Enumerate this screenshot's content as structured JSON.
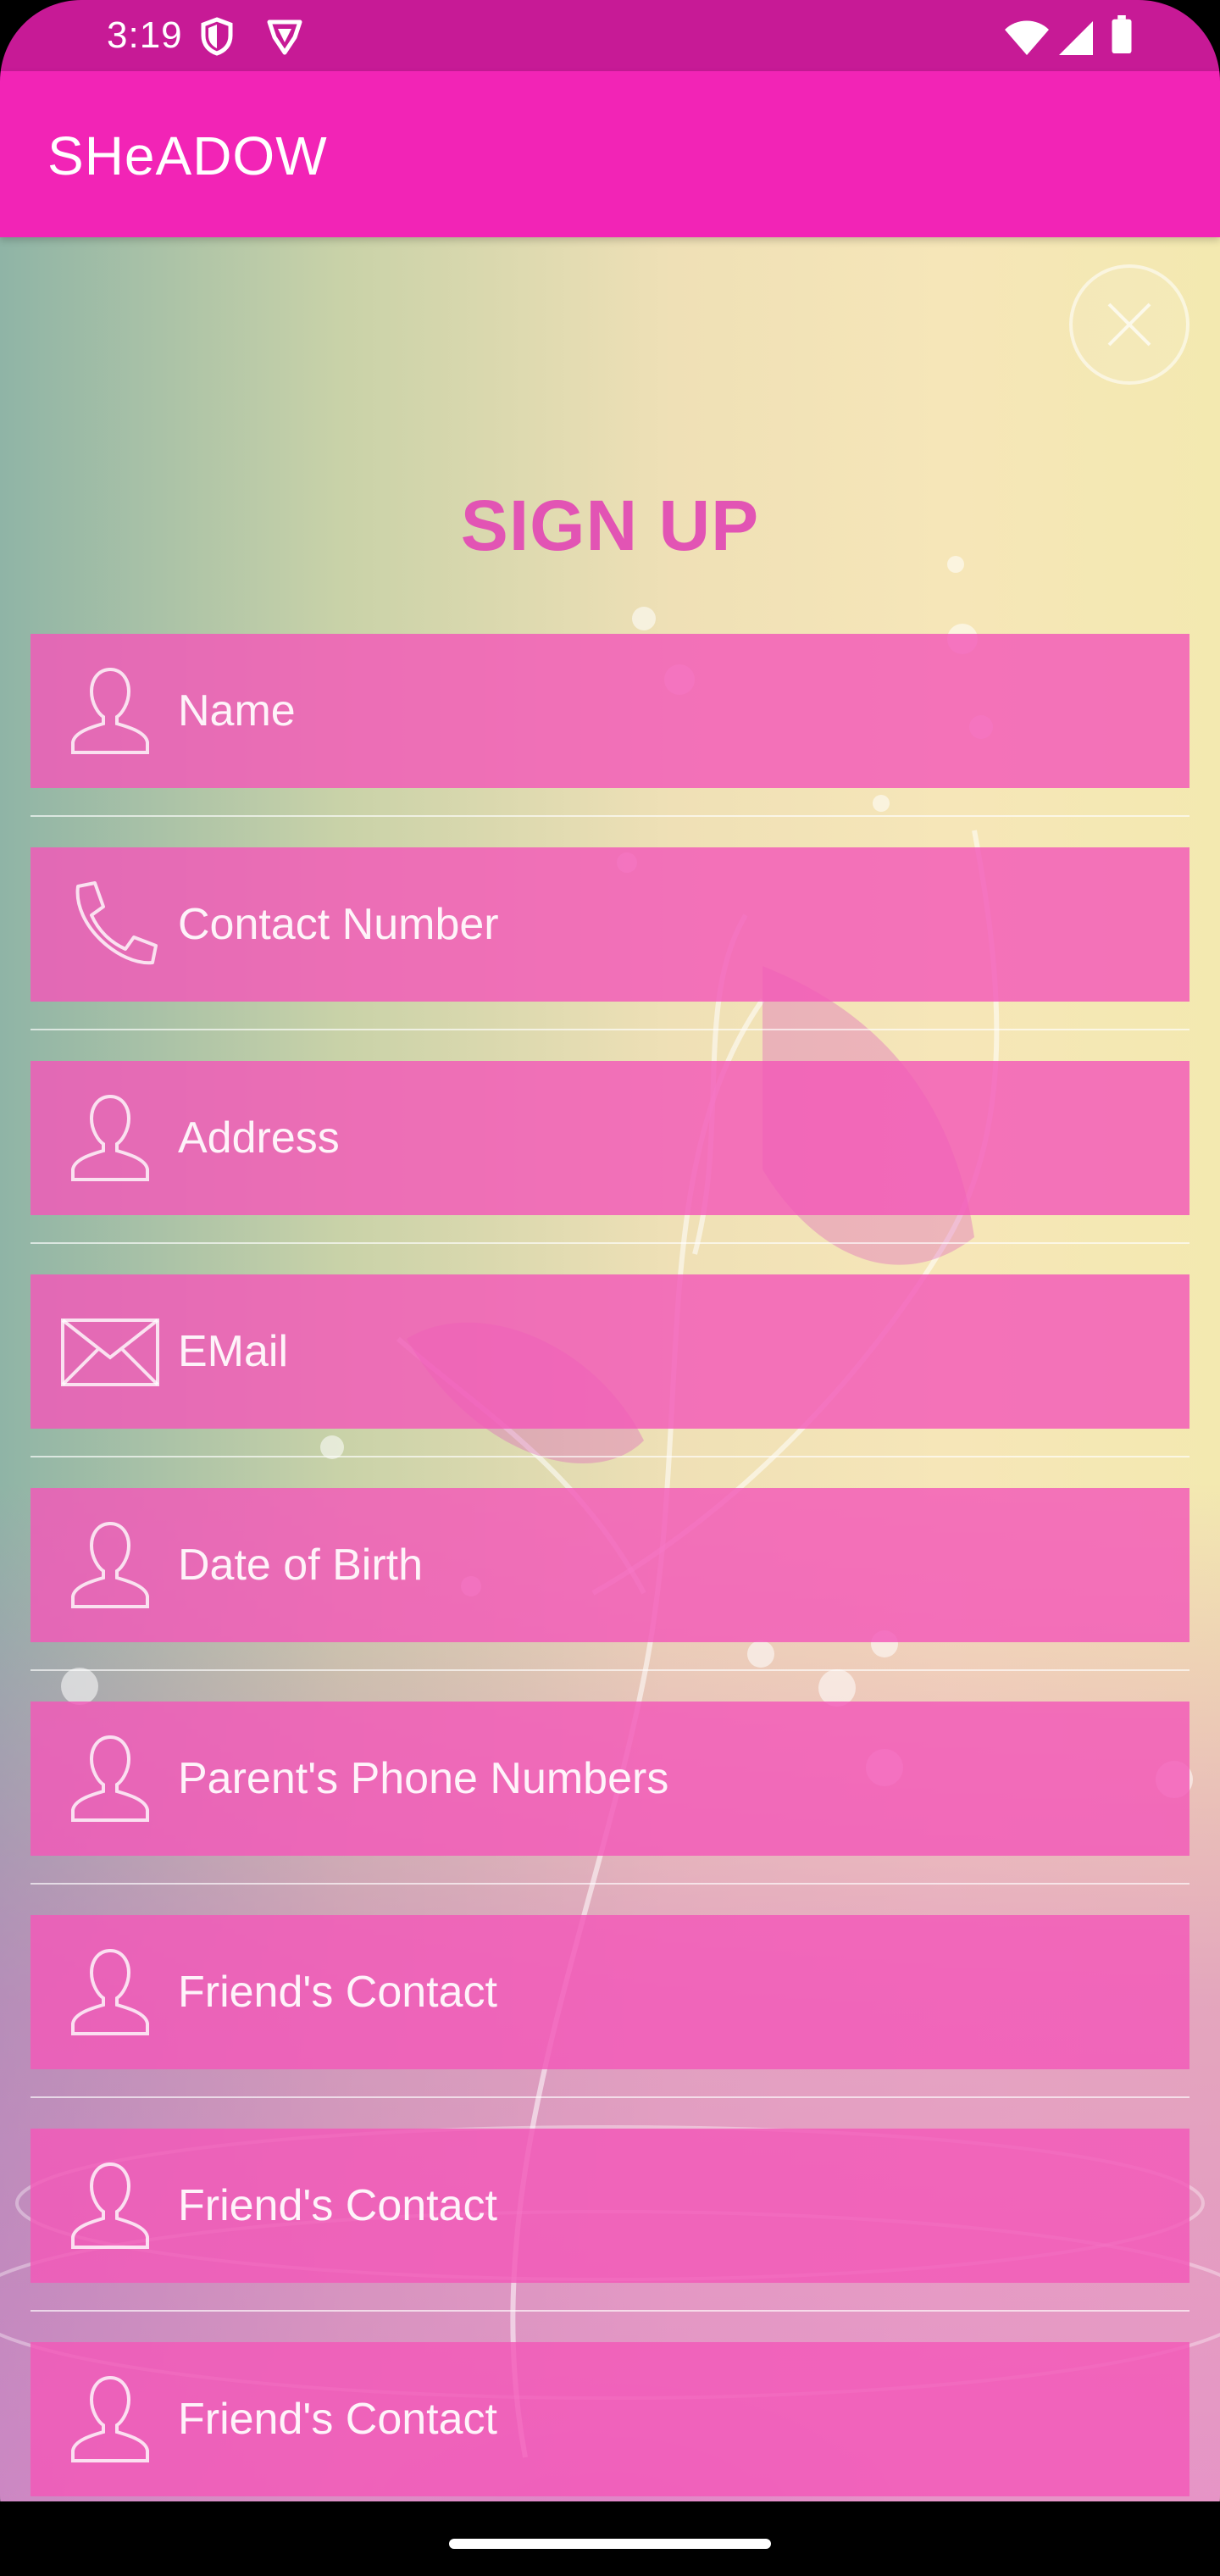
{
  "status_bar": {
    "time": "3:19",
    "icons": [
      "shield-icon",
      "vpn-shield-icon",
      "wifi-icon",
      "signal-icon",
      "battery-icon"
    ]
  },
  "app_bar": {
    "title": "SHeADOW"
  },
  "colors": {
    "status_bar": "#c71a96",
    "app_bar": "#f224b6",
    "field_background": "#f358b8",
    "title_text": "#e254b4"
  },
  "form": {
    "title": "SIGN UP",
    "close_icon": "close-icon",
    "fields": [
      {
        "icon": "person-icon",
        "placeholder": "Name"
      },
      {
        "icon": "phone-icon",
        "placeholder": "Contact Number"
      },
      {
        "icon": "person-icon",
        "placeholder": "Address"
      },
      {
        "icon": "mail-icon",
        "placeholder": "EMail"
      },
      {
        "icon": "person-icon",
        "placeholder": "Date of Birth"
      },
      {
        "icon": "person-icon",
        "placeholder": "Parent's Phone Numbers"
      },
      {
        "icon": "person-icon",
        "placeholder": "Friend's Contact"
      },
      {
        "icon": "person-icon",
        "placeholder": "Friend's Contact"
      },
      {
        "icon": "person-icon",
        "placeholder": "Friend's Contact"
      }
    ]
  }
}
